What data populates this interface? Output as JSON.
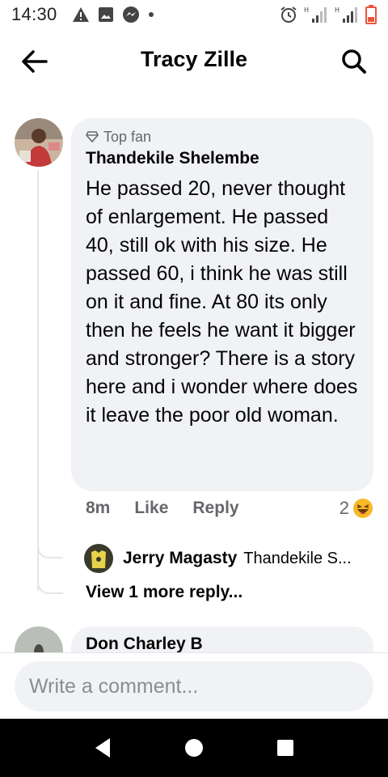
{
  "status_bar": {
    "time": "14:30",
    "left_icons": [
      "warning-icon",
      "image-icon",
      "messenger-icon",
      "dot-icon"
    ],
    "right_icons": [
      "alarm-icon",
      "signal-h-icon",
      "signal-h2-icon",
      "battery-low-icon"
    ]
  },
  "header": {
    "title": "Tracy Zille",
    "back_icon": "back-arrow-icon",
    "search_icon": "search-icon"
  },
  "comment": {
    "badge": "Top fan",
    "author": "Thandekile Shelembe",
    "text": "He passed 20, never thought of enlargement. He passed 40, still ok with his size. He passed 60, i think he was still on it and fine. At 80 its only then he feels he want it bigger and stronger? There is a story here and i wonder where does it leave the poor old woman.",
    "time": "8m",
    "like_label": "Like",
    "reply_label": "Reply",
    "reaction_count": "2",
    "reaction_icon": "haha-emoji-icon"
  },
  "reply": {
    "author": "Jerry Magasty",
    "preview": "Thandekile S..."
  },
  "view_more_label": "View 1 more reply...",
  "next_comment": {
    "author": "Don Charley B"
  },
  "composer": {
    "placeholder": "Write a comment..."
  },
  "nav": [
    "back-triangle-icon",
    "home-circle-icon",
    "recents-square-icon"
  ],
  "colors": {
    "bubble": "#f0f2f5",
    "secondary_text": "#65676b",
    "battery": "#e8553e",
    "navbar": "#000000"
  }
}
